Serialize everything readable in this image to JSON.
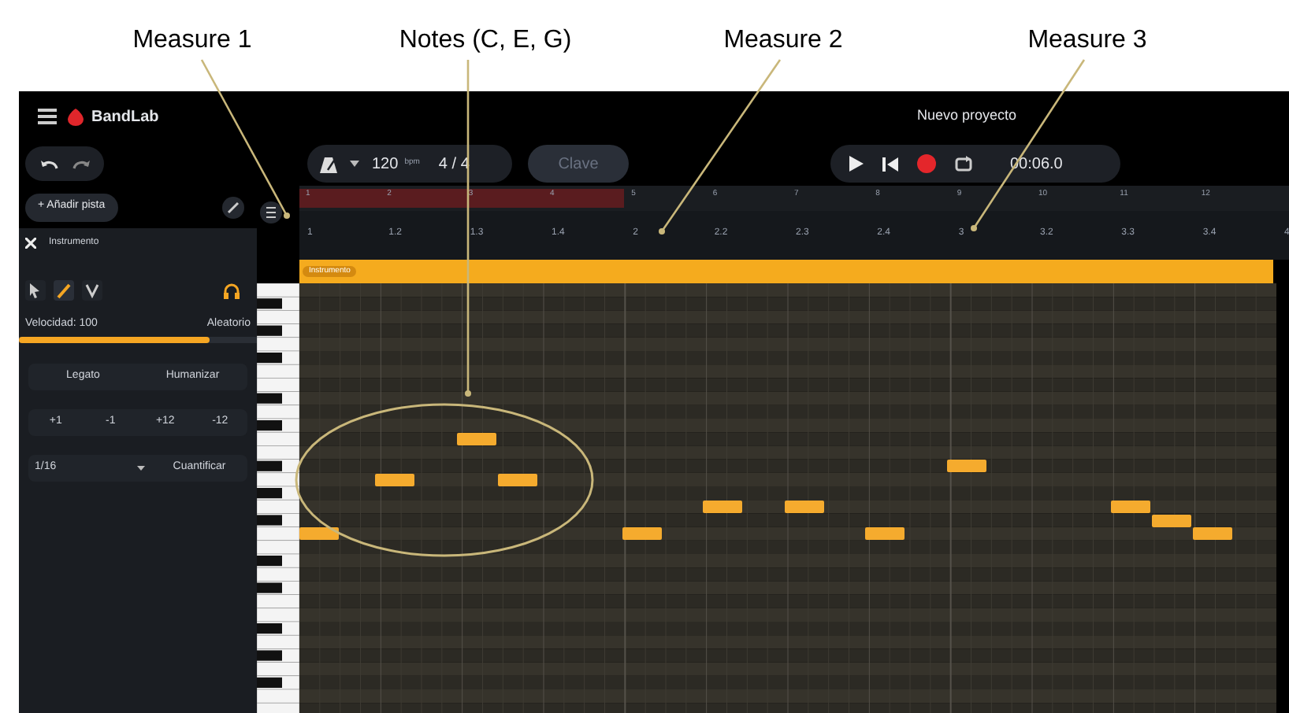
{
  "annotations": [
    {
      "label": "Measure 1"
    },
    {
      "label": "Notes (C, E, G)"
    },
    {
      "label": "Measure 2"
    },
    {
      "label": "Measure 3"
    }
  ],
  "header": {
    "logo": "BandLab",
    "project_title": "Nuevo proyecto"
  },
  "toolbar": {
    "tempo": "120",
    "tempo_unit": "bpm",
    "time_signature": "4 / 4",
    "key_button": "Clave",
    "time": "00:06.0"
  },
  "track_panel": {
    "add_track": "+ Añadir pista",
    "title": "Instrumento"
  },
  "tools": [
    {
      "kind": "pointer",
      "selected": false
    },
    {
      "kind": "pencil",
      "selected": true
    },
    {
      "kind": "velocity",
      "selected": false
    }
  ],
  "velocity": {
    "label": "Velocidad: 100",
    "random_button": "Aleatorio",
    "level": 0.8
  },
  "actions": [
    "Legato",
    "Humanizar"
  ],
  "transpose": [
    "+1",
    "-1",
    "+12",
    "-12"
  ],
  "quantize": {
    "value": "1/16",
    "button": "Cuantificar"
  },
  "ruler": {
    "bars": [
      "1",
      "2",
      "3",
      "4",
      "5",
      "6",
      "7",
      "8",
      "9",
      "10",
      "11",
      "12"
    ],
    "beats": [
      "1",
      "1.2",
      "1.3",
      "1.4",
      "2",
      "2.2",
      "2.3",
      "2.4",
      "3",
      "3.2",
      "3.3",
      "3.4",
      "4"
    ]
  },
  "clip": {
    "label": "Instrumento"
  }
}
